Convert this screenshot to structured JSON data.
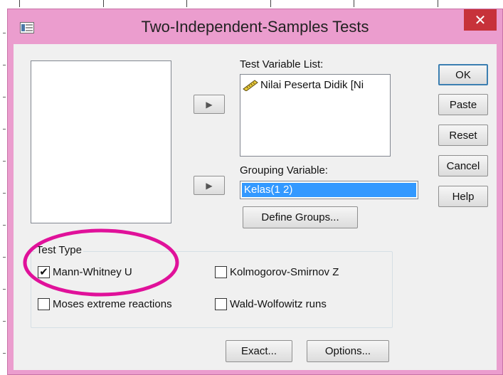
{
  "window": {
    "title": "Two-Independent-Samples Tests",
    "close_glyph": "✕"
  },
  "source_list": {
    "items": []
  },
  "test_variable": {
    "label": "Test Variable List:",
    "items": [
      {
        "name": "Nilai Peserta Didik  [Ni",
        "icon": "scale-ruler-icon"
      }
    ]
  },
  "grouping": {
    "label": "Grouping Variable:",
    "value": "Kelas(1 2)",
    "define_groups_label": "Define Groups..."
  },
  "arrow_glyph": "▶",
  "buttons": {
    "ok": "OK",
    "paste": "Paste",
    "reset": "Reset",
    "cancel": "Cancel",
    "help": "Help",
    "exact": "Exact...",
    "options": "Options..."
  },
  "test_type": {
    "legend": "Test Type",
    "options": [
      {
        "label": "Mann-Whitney U",
        "checked": true
      },
      {
        "label": "Kolmogorov-Smirnov Z",
        "checked": false
      },
      {
        "label": "Moses extreme reactions",
        "checked": false
      },
      {
        "label": "Wald-Wolfowitz runs",
        "checked": false
      }
    ]
  },
  "colors": {
    "window_frame": "#eb9dce",
    "close_button": "#c7323a",
    "selection": "#3399ff",
    "annotation": "#e0119a"
  }
}
